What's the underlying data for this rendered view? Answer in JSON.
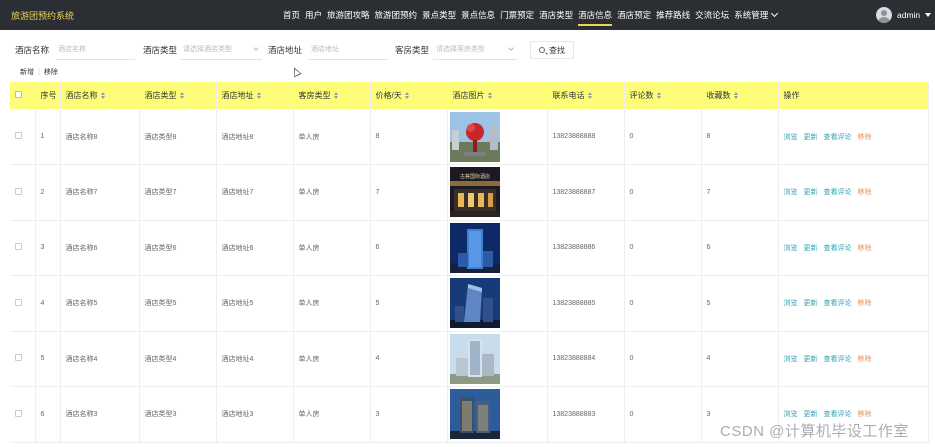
{
  "header": {
    "brand": "旅游团预约系统",
    "nav": [
      "首页",
      "用户",
      "旅游团攻略",
      "旅游团预约",
      "景点类型",
      "景点信息",
      "门票预定",
      "酒店类型",
      "酒店信息",
      "酒店预定",
      "推荐路线",
      "交流论坛",
      "系统管理"
    ],
    "active_nav": "酒店信息",
    "user": "admin"
  },
  "search": {
    "name_label": "酒店名称",
    "name_placeholder": "酒店名称",
    "type_label": "酒店类型",
    "type_placeholder": "请选择酒店类型",
    "address_label": "酒店地址",
    "address_placeholder": "酒店地址",
    "room_label": "客房类型",
    "room_placeholder": "请选择客房类型",
    "button": "查找"
  },
  "actions": {
    "add": "新增",
    "sep": "|",
    "remove": "移除"
  },
  "table": {
    "columns": [
      "序号",
      "酒店名称",
      "酒店类型",
      "酒店地址",
      "客房类型",
      "价格/天",
      "酒店图片",
      "联系电话",
      "评论数",
      "收藏数",
      "操作"
    ],
    "ops": {
      "view": "浏览",
      "edit": "更新",
      "review": "查看评论",
      "delete": "移除"
    },
    "rows": [
      {
        "no": "1",
        "name": "酒店名称8",
        "type": "酒店类型8",
        "address": "酒店地址8",
        "room": "单人房",
        "price": "8",
        "phone": "13823888888",
        "comments": "0",
        "favorites": "8",
        "image": "red-sculpture"
      },
      {
        "no": "2",
        "name": "酒店名称7",
        "type": "酒店类型7",
        "address": "酒店地址7",
        "room": "单人房",
        "price": "7",
        "phone": "13823888887",
        "comments": "0",
        "favorites": "7",
        "image": "hotel-night",
        "image_text": "古荟国际酒店"
      },
      {
        "no": "3",
        "name": "酒店名称6",
        "type": "酒店类型6",
        "address": "酒店地址6",
        "room": "单人房",
        "price": "6",
        "phone": "13823888886",
        "comments": "0",
        "favorites": "6",
        "image": "tower-night"
      },
      {
        "no": "4",
        "name": "酒店名称5",
        "type": "酒店类型5",
        "address": "酒店地址5",
        "room": "单人房",
        "price": "5",
        "phone": "13823888885",
        "comments": "0",
        "favorites": "5",
        "image": "tower-blue"
      },
      {
        "no": "5",
        "name": "酒店名称4",
        "type": "酒店类型4",
        "address": "酒店地址4",
        "room": "单人房",
        "price": "4",
        "phone": "13823888884",
        "comments": "0",
        "favorites": "4",
        "image": "tower-day"
      },
      {
        "no": "6",
        "name": "酒店名称3",
        "type": "酒店类型3",
        "address": "酒店地址3",
        "room": "单人房",
        "price": "3",
        "phone": "13823888883",
        "comments": "0",
        "favorites": "3",
        "image": "tower-dusk"
      }
    ]
  },
  "watermark": "CSDN @计算机毕设工作室"
}
